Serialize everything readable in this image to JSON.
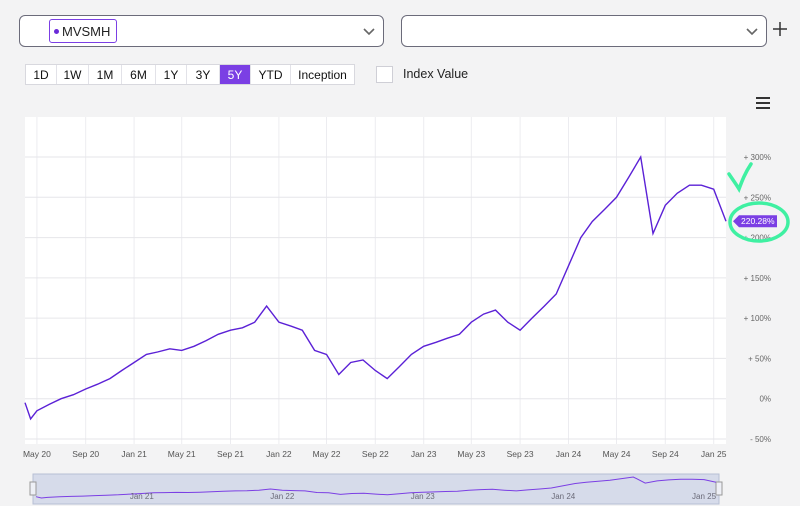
{
  "selectors": {
    "primary": {
      "chip": "MVSMH"
    },
    "secondary": {
      "value": ""
    }
  },
  "ranges": [
    {
      "label": "1D",
      "active": false
    },
    {
      "label": "1W",
      "active": false
    },
    {
      "label": "1M",
      "active": false
    },
    {
      "label": "6M",
      "active": false
    },
    {
      "label": "1Y",
      "active": false
    },
    {
      "label": "3Y",
      "active": false
    },
    {
      "label": "5Y",
      "active": true
    },
    {
      "label": "YTD",
      "active": false
    },
    {
      "label": "Inception",
      "active": false
    }
  ],
  "index_value": {
    "label": "Index Value",
    "checked": false
  },
  "colors": {
    "accent": "#7b3fe4",
    "line": "#5b21d6",
    "annotation": "#3ff0a2"
  },
  "chart_data": {
    "type": "line",
    "series": [
      {
        "x": [
          "2020-04-01",
          "2020-04-15",
          "2020-05-01",
          "2020-06-01",
          "2020-07-01",
          "2020-08-01",
          "2020-09-01",
          "2020-10-01",
          "2020-11-01",
          "2020-12-01",
          "2021-01-01",
          "2021-02-01",
          "2021-03-01",
          "2021-04-01",
          "2021-05-01",
          "2021-06-01",
          "2021-07-01",
          "2021-08-01",
          "2021-09-01",
          "2021-10-01",
          "2021-11-01",
          "2021-12-01",
          "2022-01-01",
          "2022-02-01",
          "2022-03-01",
          "2022-04-01",
          "2022-05-01",
          "2022-06-01",
          "2022-07-01",
          "2022-08-01",
          "2022-09-01",
          "2022-10-01",
          "2022-11-01",
          "2022-12-01",
          "2023-01-01",
          "2023-02-01",
          "2023-03-01",
          "2023-04-01",
          "2023-05-01",
          "2023-06-01",
          "2023-07-01",
          "2023-08-01",
          "2023-09-01",
          "2023-10-01",
          "2023-11-01",
          "2023-12-01",
          "2024-01-01",
          "2024-02-01",
          "2024-03-01",
          "2024-04-01",
          "2024-05-01",
          "2024-06-01",
          "2024-07-01",
          "2024-08-01",
          "2024-09-01",
          "2024-10-01",
          "2024-11-01",
          "2024-12-01",
          "2025-01-01",
          "2025-02-01"
        ],
        "values": [
          -5,
          -25,
          -15,
          -7,
          0,
          5,
          12,
          18,
          25,
          35,
          45,
          55,
          58,
          62,
          60,
          65,
          72,
          80,
          85,
          88,
          95,
          115,
          95,
          90,
          85,
          60,
          55,
          30,
          45,
          48,
          35,
          25,
          40,
          55,
          65,
          70,
          75,
          80,
          95,
          105,
          110,
          95,
          85,
          100,
          115,
          130,
          165,
          200,
          220,
          235,
          250,
          275,
          300,
          205,
          240,
          255,
          265,
          265,
          260,
          220.28
        ]
      }
    ],
    "x_tick_labels": [
      "May 20",
      "Sep 20",
      "Jan 21",
      "May 21",
      "Sep 21",
      "Jan 22",
      "May 22",
      "Sep 22",
      "Jan 23",
      "May 23",
      "Sep 23",
      "Jan 24",
      "May 24",
      "Sep 24",
      "Jan 25"
    ],
    "y_ticks": [
      300,
      250,
      200,
      150,
      100,
      50,
      0,
      -50
    ],
    "y_tick_labels": [
      "+ 300%",
      "+ 250%",
      "+ 200%",
      "+ 150%",
      "+ 100%",
      "+ 50%",
      "0%",
      "- 50%"
    ],
    "ylim": [
      -50,
      300
    ],
    "last_value_label": "220.28%",
    "navigator_tick_labels": [
      "Jan 21",
      "Jan 22",
      "Jan 23",
      "Jan 24",
      "Jan 25"
    ],
    "grid": true
  }
}
